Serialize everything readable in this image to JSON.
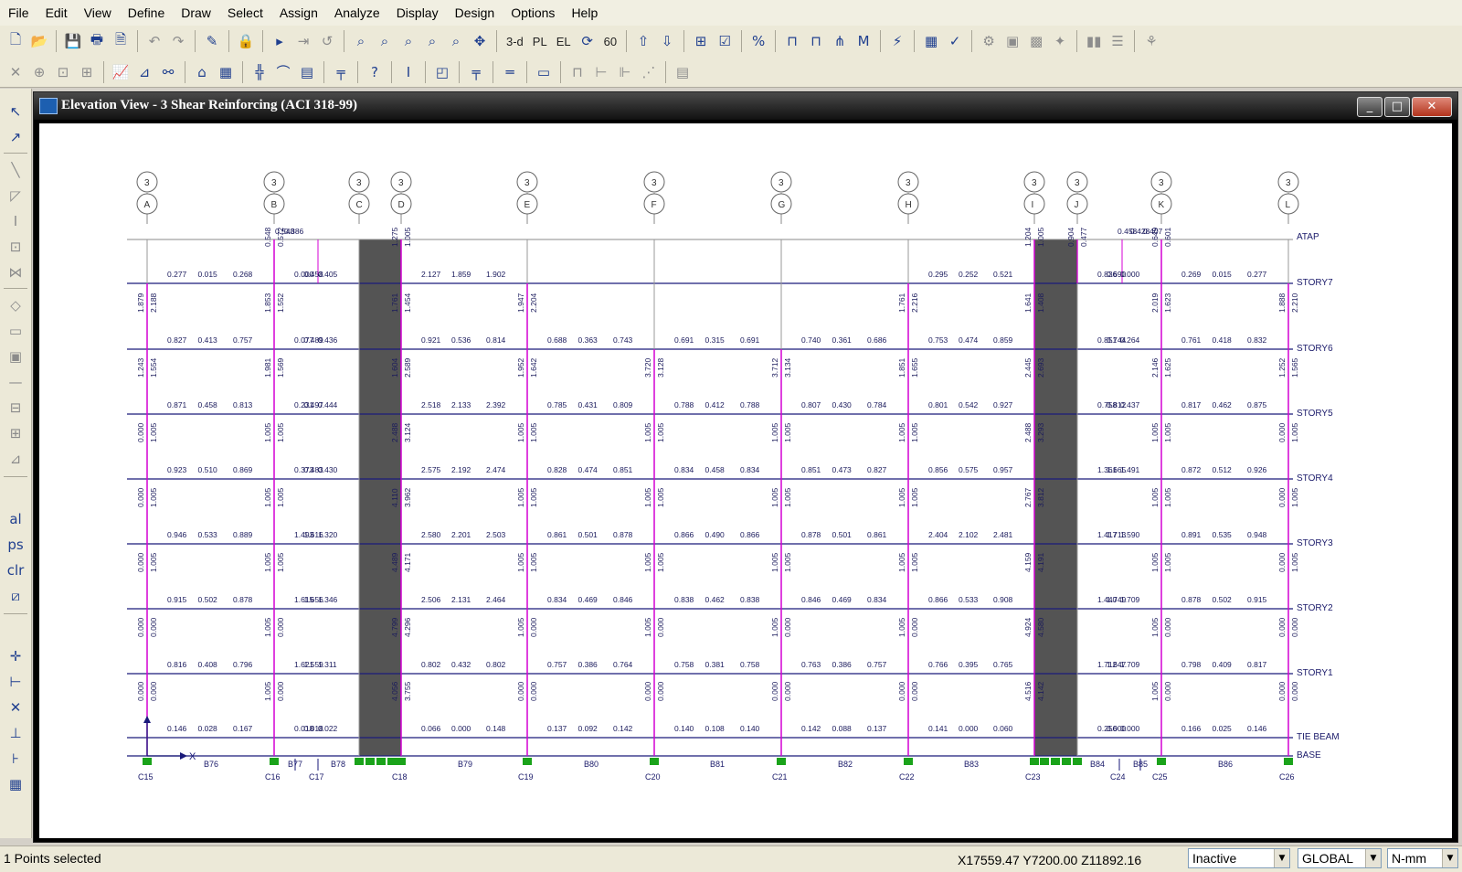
{
  "menu": [
    "File",
    "Edit",
    "View",
    "Define",
    "Draw",
    "Select",
    "Assign",
    "Analyze",
    "Display",
    "Design",
    "Options",
    "Help"
  ],
  "toolbar_row1": [
    {
      "name": "new-file-icon",
      "glyph": "🗋"
    },
    {
      "name": "open-file-icon",
      "glyph": "📂"
    },
    "|",
    {
      "name": "save-icon",
      "glyph": "💾"
    },
    {
      "name": "print-icon",
      "glyph": "🖶"
    },
    {
      "name": "print-tables-icon",
      "glyph": "🗎"
    },
    "|",
    {
      "name": "undo-icon",
      "glyph": "↶",
      "grey": true
    },
    {
      "name": "redo-icon",
      "glyph": "↷",
      "grey": true
    },
    "|",
    {
      "name": "edit-pencil-icon",
      "glyph": "✎"
    },
    "|",
    {
      "name": "lock-icon",
      "glyph": "🔒"
    },
    "|",
    {
      "name": "run-analysis-icon",
      "glyph": "▸"
    },
    {
      "name": "run-step-icon",
      "glyph": "⇥",
      "grey": true
    },
    {
      "name": "refresh-window-icon",
      "glyph": "↺",
      "grey": true
    },
    "|",
    {
      "name": "zoom-window-icon",
      "glyph": "⌕"
    },
    {
      "name": "zoom-full-icon",
      "glyph": "⌕"
    },
    {
      "name": "zoom-previous-icon",
      "glyph": "⌕"
    },
    {
      "name": "zoom-in-icon",
      "glyph": "⌕"
    },
    {
      "name": "zoom-out-icon",
      "glyph": "⌕"
    },
    {
      "name": "pan-icon",
      "glyph": "✥"
    },
    "|",
    {
      "name": "view-3d-icon",
      "glyph": "3-d",
      "label": true
    },
    {
      "name": "plan-view-icon",
      "glyph": "PL",
      "label": true
    },
    {
      "name": "elevation-view-icon",
      "glyph": "EL",
      "label": true
    },
    {
      "name": "rotate-view-icon",
      "glyph": "⟳"
    },
    {
      "name": "perspective-icon",
      "glyph": "60",
      "label": true
    },
    "|",
    {
      "name": "move-up-icon",
      "glyph": "⇧"
    },
    {
      "name": "move-down-icon",
      "glyph": "⇩"
    },
    "|",
    {
      "name": "object-shrink-icon",
      "glyph": "⊞"
    },
    {
      "name": "set-display-icon",
      "glyph": "☑"
    },
    "|",
    {
      "name": "percent-icon",
      "glyph": "%"
    },
    "|",
    {
      "name": "frame-icon",
      "glyph": "⊓"
    },
    {
      "name": "frame-loads-icon",
      "glyph": "⊓"
    },
    {
      "name": "forces-icon",
      "glyph": "⋔"
    },
    {
      "name": "moments-icon",
      "glyph": "M"
    },
    "|",
    {
      "name": "lightning-icon",
      "glyph": "⚡"
    },
    "|",
    {
      "name": "design-icon",
      "glyph": "▦"
    },
    {
      "name": "check-design-icon",
      "glyph": "✓"
    },
    "|",
    {
      "name": "grey-tool-1-icon",
      "glyph": "⚙",
      "grey": true
    },
    {
      "name": "grey-tool-2-icon",
      "glyph": "▣",
      "grey": true
    },
    {
      "name": "grey-tool-3-icon",
      "glyph": "▩",
      "grey": true
    },
    {
      "name": "grey-tool-4-icon",
      "glyph": "✦",
      "grey": true
    },
    "|",
    {
      "name": "grey-tool-5-icon",
      "glyph": "▮▮",
      "grey": true
    },
    {
      "name": "grey-tool-6-icon",
      "glyph": "☰",
      "grey": true
    },
    "|",
    {
      "name": "grey-tool-7-icon",
      "glyph": "⚘",
      "grey": true
    }
  ],
  "toolbar_row2": [
    {
      "name": "draw-x-icon",
      "glyph": "✕",
      "grey": true
    },
    {
      "name": "snap-point-icon",
      "glyph": "⊕",
      "grey": true
    },
    {
      "name": "snap-grid-icon",
      "glyph": "⊡",
      "grey": true
    },
    {
      "name": "snap-more-icon",
      "glyph": "⊞",
      "grey": true
    },
    "|",
    {
      "name": "chart-icon",
      "glyph": "📈"
    },
    {
      "name": "filter-icon",
      "glyph": "⊿"
    },
    {
      "name": "link-icon",
      "glyph": "⚯"
    },
    "|",
    {
      "name": "shape-icon",
      "glyph": "⌂"
    },
    {
      "name": "grid-icon",
      "glyph": "▦"
    },
    "|",
    {
      "name": "member-icon",
      "glyph": "╬"
    },
    {
      "name": "area-icon",
      "glyph": "⌒"
    },
    {
      "name": "mesh-icon",
      "glyph": "▤"
    },
    "|",
    {
      "name": "joint-restraint-icon",
      "glyph": "╤"
    },
    "|",
    {
      "name": "question-icon",
      "glyph": "?"
    },
    "|",
    {
      "name": "section-i-icon",
      "glyph": "I"
    },
    "|",
    {
      "name": "area-section-icon",
      "glyph": "◰"
    },
    "|",
    {
      "name": "column-icon",
      "glyph": "╤"
    },
    "|",
    {
      "name": "beam-icon",
      "glyph": "═"
    },
    "|",
    {
      "name": "wall-icon",
      "glyph": "▭"
    },
    "|",
    {
      "name": "grey-section-1-icon",
      "glyph": "⊓",
      "grey": true
    },
    {
      "name": "grey-section-2-icon",
      "glyph": "⊢",
      "grey": true
    },
    {
      "name": "grey-section-3-icon",
      "glyph": "⊩",
      "grey": true
    },
    {
      "name": "grey-section-4-icon",
      "glyph": "⋰",
      "grey": true
    },
    "|",
    {
      "name": "grey-section-5-icon",
      "glyph": "▤",
      "grey": true
    }
  ],
  "window": {
    "title": "Elevation View - 3  Shear Reinforcing  (ACI 318-99)"
  },
  "grid_bubbles": [
    {
      "line": "3",
      "label": "A"
    },
    {
      "line": "3",
      "label": "B"
    },
    {
      "line": "3",
      "label": "C"
    },
    {
      "line": "3",
      "label": "D"
    },
    {
      "line": "3",
      "label": "E"
    },
    {
      "line": "3",
      "label": "F"
    },
    {
      "line": "3",
      "label": "G"
    },
    {
      "line": "3",
      "label": "H"
    },
    {
      "line": "3",
      "label": "I"
    },
    {
      "line": "3",
      "label": "J"
    },
    {
      "line": "3",
      "label": "K"
    },
    {
      "line": "3",
      "label": "L"
    }
  ],
  "stories": [
    "ATAP",
    "STORY7",
    "STORY6",
    "STORY5",
    "STORY4",
    "STORY3",
    "STORY2",
    "STORY1",
    "TIE BEAM",
    "BASE"
  ],
  "base_labels": [
    "C15",
    "B76",
    "C16",
    "B77",
    "C17",
    "B78",
    "C18",
    "B79",
    "C19",
    "B80",
    "C20",
    "B81",
    "C21",
    "B82",
    "C22",
    "B83",
    "C23",
    "B84",
    "C24",
    "B85",
    "C25",
    "B86",
    "C26"
  ],
  "beam_values": {
    "STORY7": [
      [
        "0.277",
        "0.015",
        "0.268"
      ],
      [
        "0.000",
        "0.458",
        "0.405"
      ],
      [
        "2.127",
        "1.859",
        "1.902"
      ],
      [],
      [],
      [],
      [
        "0.295",
        "0.252",
        "0.521"
      ],
      [
        "0.836",
        "0.690",
        "0.000"
      ],
      [
        "0.269",
        "0.015",
        "0.277"
      ]
    ],
    "STORY6": [
      [
        "0.827",
        "0.413",
        "0.757"
      ],
      [
        "0.077",
        "0.489",
        "0.436"
      ],
      [
        "0.921",
        "0.536",
        "0.814"
      ],
      [
        "0.688",
        "0.363",
        "0.743"
      ],
      [
        "0.691",
        "0.315",
        "0.691"
      ],
      [
        "0.740",
        "0.361",
        "0.686"
      ],
      [
        "0.753",
        "0.474",
        "0.859"
      ],
      [
        "0.851",
        "0.744",
        "0.264"
      ],
      [
        "0.761",
        "0.418",
        "0.832"
      ]
    ],
    "STORY5": [
      [
        "0.871",
        "0.458",
        "0.813"
      ],
      [
        "0.231",
        "0.497",
        "0.444"
      ],
      [
        "2.518",
        "2.133",
        "2.392"
      ],
      [
        "0.785",
        "0.431",
        "0.809"
      ],
      [
        "0.788",
        "0.412",
        "0.788"
      ],
      [
        "0.807",
        "0.430",
        "0.784"
      ],
      [
        "0.801",
        "0.542",
        "0.927"
      ],
      [
        "0.758",
        "0.812",
        "0.437"
      ],
      [
        "0.817",
        "0.462",
        "0.875"
      ]
    ],
    "STORY4": [
      [
        "0.923",
        "0.510",
        "0.869"
      ],
      [
        "0.373",
        "0.483",
        "0.430"
      ],
      [
        "2.575",
        "2.192",
        "2.474"
      ],
      [
        "0.828",
        "0.474",
        "0.851"
      ],
      [
        "0.834",
        "0.458",
        "0.834"
      ],
      [
        "0.851",
        "0.473",
        "0.827"
      ],
      [
        "0.856",
        "0.575",
        "0.957"
      ],
      [
        "1.361",
        "1.665",
        "1.491"
      ],
      [
        "0.872",
        "0.512",
        "0.926"
      ]
    ],
    "STORY3": [
      [
        "0.946",
        "0.533",
        "0.889"
      ],
      [
        "1.493",
        "1.616",
        "1.320"
      ],
      [
        "2.580",
        "2.201",
        "2.503"
      ],
      [
        "0.861",
        "0.501",
        "0.878"
      ],
      [
        "0.866",
        "0.490",
        "0.866"
      ],
      [
        "0.878",
        "0.501",
        "0.861"
      ],
      [
        "2.404",
        "2.102",
        "2.481"
      ],
      [
        "1.417",
        "1.713",
        "1.590"
      ],
      [
        "0.891",
        "0.535",
        "0.948"
      ]
    ],
    "STORY2": [
      [
        "0.915",
        "0.502",
        "0.878"
      ],
      [
        "1.615",
        "1.656",
        "1.346"
      ],
      [
        "2.506",
        "2.131",
        "2.464"
      ],
      [
        "0.834",
        "0.469",
        "0.846"
      ],
      [
        "0.838",
        "0.462",
        "0.838"
      ],
      [
        "0.846",
        "0.469",
        "0.834"
      ],
      [
        "0.866",
        "0.533",
        "0.908"
      ],
      [
        "1.440",
        "1.749",
        "1.709"
      ],
      [
        "0.878",
        "0.502",
        "0.915"
      ]
    ],
    "STORY1": [
      [
        "0.816",
        "0.408",
        "0.796"
      ],
      [
        "1.621",
        "1.559",
        "1.311"
      ],
      [
        "0.802",
        "0.432",
        "0.802"
      ],
      [
        "0.757",
        "0.386",
        "0.764"
      ],
      [
        "0.758",
        "0.381",
        "0.758"
      ],
      [
        "0.763",
        "0.386",
        "0.757"
      ],
      [
        "0.766",
        "0.395",
        "0.765"
      ],
      [
        "1.712",
        "1.647",
        "1.709"
      ],
      [
        "0.798",
        "0.409",
        "0.817"
      ]
    ],
    "TIE BEAM": [
      [
        "0.146",
        "0.028",
        "0.167"
      ],
      [
        "0.018",
        "0.018",
        "0.022"
      ],
      [
        "0.066",
        "0.000",
        "0.148"
      ],
      [
        "0.137",
        "0.092",
        "0.142"
      ],
      [
        "0.140",
        "0.108",
        "0.140"
      ],
      [
        "0.142",
        "0.088",
        "0.137"
      ],
      [
        "0.141",
        "0.000",
        "0.060"
      ],
      [
        "0.256",
        "0.000",
        "0.000"
      ],
      [
        "0.166",
        "0.025",
        "0.146"
      ]
    ]
  },
  "column_values": {
    "A": [
      [
        "",
        ""
      ],
      [
        "1.879",
        "2.188"
      ],
      [
        "1.243",
        "1.554"
      ],
      [
        "0.000",
        "1.005"
      ],
      [
        "0.000",
        "1.005"
      ],
      [
        "0.000",
        "1.005"
      ],
      [
        "0.000",
        "0.000"
      ],
      [
        "0.000",
        "0.000"
      ]
    ],
    "B": [
      [
        "0.548",
        "0.572"
      ],
      [
        "1.853",
        "1.552"
      ],
      [
        "1.981",
        "1.569"
      ],
      [
        "1.005",
        "1.005"
      ],
      [
        "1.005",
        "1.005"
      ],
      [
        "1.005",
        "1.005"
      ],
      [
        "1.005",
        "0.000"
      ],
      [
        "1.005",
        "0.000"
      ]
    ],
    "C": [
      [
        "",
        ""
      ],
      [
        "",
        ""
      ],
      [
        "",
        ""
      ],
      [
        "",
        ""
      ],
      [
        "",
        ""
      ],
      [
        "",
        ""
      ],
      [
        "",
        ""
      ],
      [
        "",
        ""
      ]
    ],
    "D": [
      [
        "1.275",
        "1.005"
      ],
      [
        "1.761",
        "1.454"
      ],
      [
        "1.604",
        "2.589"
      ],
      [
        "2.488",
        "3.124"
      ],
      [
        "4.110",
        "3.962"
      ],
      [
        "4.489",
        "4.171"
      ],
      [
        "4.799",
        "4.296"
      ],
      [
        "4.056",
        "3.755"
      ]
    ],
    "E": [
      [
        "",
        ""
      ],
      [
        "1.947",
        "2.204"
      ],
      [
        "1.952",
        "1.642"
      ],
      [
        "1.005",
        "1.005"
      ],
      [
        "1.005",
        "1.005"
      ],
      [
        "1.005",
        "1.005"
      ],
      [
        "1.005",
        "0.000"
      ],
      [
        "0.000",
        "0.000"
      ]
    ],
    "F": [
      [
        "",
        ""
      ],
      [
        "",
        ""
      ],
      [
        "3.720",
        "3.128"
      ],
      [
        "1.005",
        "1.005"
      ],
      [
        "1.005",
        "1.005"
      ],
      [
        "1.005",
        "1.005"
      ],
      [
        "1.005",
        "0.000"
      ],
      [
        "0.000",
        "0.000"
      ]
    ],
    "G": [
      [
        "",
        ""
      ],
      [
        "",
        ""
      ],
      [
        "3.712",
        "3.134"
      ],
      [
        "1.005",
        "1.005"
      ],
      [
        "1.005",
        "1.005"
      ],
      [
        "1.005",
        "1.005"
      ],
      [
        "1.005",
        "0.000"
      ],
      [
        "0.000",
        "0.000"
      ]
    ],
    "H": [
      [
        "",
        ""
      ],
      [
        "1.761",
        "2.216"
      ],
      [
        "1.851",
        "1.655"
      ],
      [
        "1.005",
        "1.005"
      ],
      [
        "1.005",
        "1.005"
      ],
      [
        "1.005",
        "1.005"
      ],
      [
        "1.005",
        "0.000"
      ],
      [
        "0.000",
        "0.000"
      ]
    ],
    "I": [
      [
        "1.204",
        "1.005"
      ],
      [
        "1.641",
        "1.408"
      ],
      [
        "2.445",
        "2.693"
      ],
      [
        "2.488",
        "3.293"
      ],
      [
        "2.767",
        "3.812"
      ],
      [
        "4.159",
        "4.191"
      ],
      [
        "4.924",
        "4.580"
      ],
      [
        "4.516",
        "4.142"
      ]
    ],
    "J": [
      [
        "0.904",
        "0.477"
      ],
      [
        "",
        ""
      ],
      [
        "",
        ""
      ],
      [
        "",
        ""
      ],
      [
        "",
        ""
      ],
      [
        "",
        ""
      ],
      [
        "",
        ""
      ],
      [
        "",
        ""
      ]
    ],
    "K": [
      [
        "0.649",
        "0.601"
      ],
      [
        "2.019",
        "1.623"
      ],
      [
        "2.146",
        "1.625"
      ],
      [
        "1.005",
        "1.005"
      ],
      [
        "1.005",
        "1.005"
      ],
      [
        "1.005",
        "1.005"
      ],
      [
        "1.005",
        "0.000"
      ],
      [
        "1.005",
        "0.000"
      ]
    ],
    "L": [
      [
        "",
        ""
      ],
      [
        "1.888",
        "2.210"
      ],
      [
        "1.252",
        "1.565"
      ],
      [
        "0.000",
        "1.005"
      ],
      [
        "0.000",
        "1.005"
      ],
      [
        "0.000",
        "1.005"
      ],
      [
        "0.000",
        "0.000"
      ],
      [
        "0.000",
        "0.000"
      ]
    ]
  },
  "top_small_labels": [
    "0.548",
    "0.386",
    "0.773",
    "0.503",
    "0.458",
    "0.428",
    "0.407"
  ],
  "axis_labels": {
    "x": "X",
    "z": "Z"
  },
  "colors": {
    "column": "#d400d4",
    "beam": "#1a1a7a",
    "shear_wall": "#545454",
    "grid": "#8a8a8a",
    "support": "#1aa31a",
    "text": "#1a1a5c"
  },
  "status": {
    "selection": "1 Points selected",
    "coordinates": "X17559.47  Y7200.00  Z11892.16",
    "mode": "Inactive",
    "coord_system": "GLOBAL",
    "units": "N-mm"
  },
  "window_buttons": {
    "minimize": "_",
    "maximize": "□",
    "close": "✕"
  }
}
